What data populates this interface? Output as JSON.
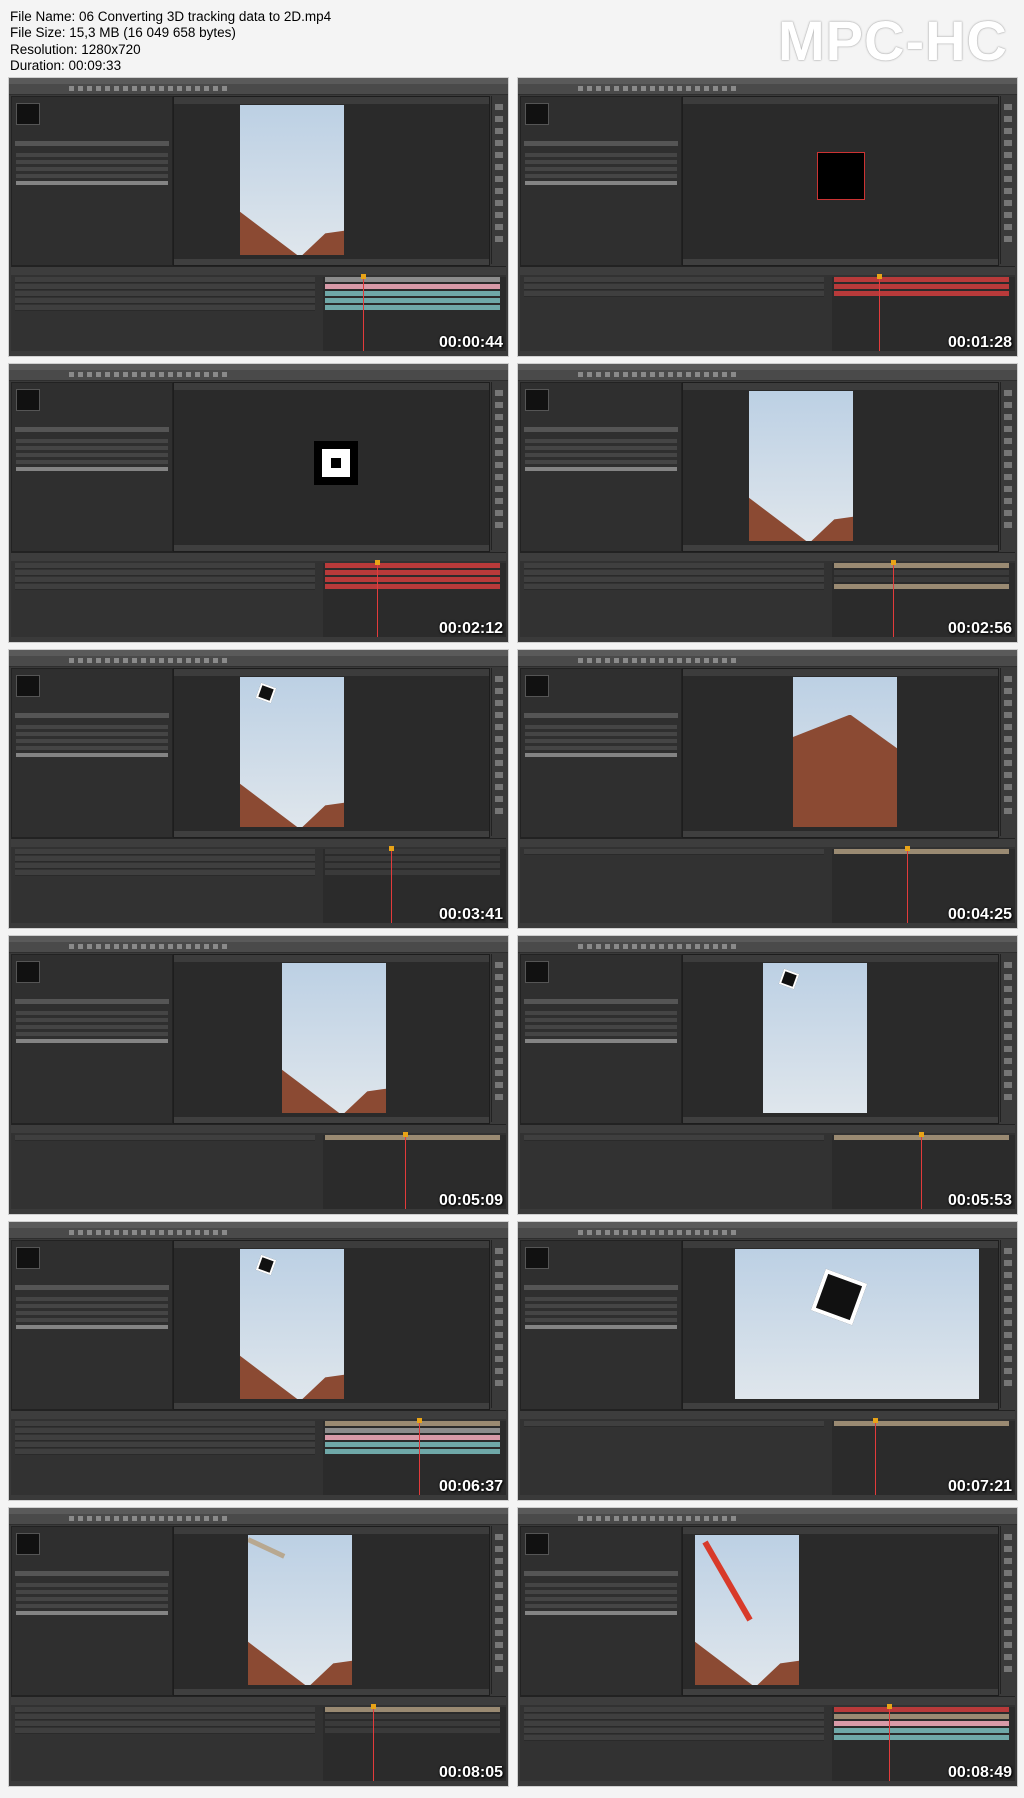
{
  "header": {
    "file_name": "File Name: 06 Converting 3D tracking data to 2D.mp4",
    "file_size": "File Size: 15,3 MB (16 049 658 bytes)",
    "resolution": "Resolution: 1280x720",
    "duration": "Duration: 00:09:33",
    "logo": "MPC-HC"
  },
  "thumbnails": [
    {
      "timestamp": "00:00:44",
      "viewer": "house-portrait",
      "tracks": [
        "#8c8c8c",
        "#d89aa8",
        "#6fa8a8",
        "#6fa8a8",
        "#6fa8a8"
      ]
    },
    {
      "timestamp": "00:01:28",
      "viewer": "black-square",
      "tracks": [
        "#b83a3a",
        "#b83a3a",
        "#b83a3a"
      ]
    },
    {
      "timestamp": "00:02:12",
      "viewer": "target-marker",
      "tracks": [
        "#b83a3a",
        "#b83a3a",
        "#b83a3a",
        "#b83a3a"
      ]
    },
    {
      "timestamp": "00:02:56",
      "viewer": "house-portrait",
      "tracks": [
        "#9a8a72",
        "#3a3a3a",
        "#3a3a3a",
        "#9a8a72"
      ]
    },
    {
      "timestamp": "00:03:41",
      "viewer": "house-marker",
      "tracks": [
        "#3a3a3a",
        "#3a3a3a",
        "#3a3a3a",
        "#3a3a3a"
      ]
    },
    {
      "timestamp": "00:04:25",
      "viewer": "house-wide",
      "tracks": [
        "#9a8a72"
      ]
    },
    {
      "timestamp": "00:05:09",
      "viewer": "house-text",
      "tracks": [
        "#9a8a72"
      ]
    },
    {
      "timestamp": "00:05:53",
      "viewer": "sky-marker",
      "tracks": [
        "#9a8a72"
      ]
    },
    {
      "timestamp": "00:06:37",
      "viewer": "house-marker",
      "tracks": [
        "#9a8a72",
        "#8c8c8c",
        "#d89aa8",
        "#6fa8a8",
        "#6fa8a8"
      ]
    },
    {
      "timestamp": "00:07:21",
      "viewer": "big-marker",
      "tracks": [
        "#9a8a72"
      ]
    },
    {
      "timestamp": "00:08:05",
      "viewer": "house-path",
      "tracks": [
        "#9a8a72",
        "#3a3a3a",
        "#3a3a3a",
        "#3a3a3a"
      ]
    },
    {
      "timestamp": "00:08:49",
      "viewer": "red-path",
      "tracks": [
        "#b83a3a",
        "#9a8a72",
        "#d89aa8",
        "#6fa8a8",
        "#6fa8a8"
      ]
    }
  ]
}
